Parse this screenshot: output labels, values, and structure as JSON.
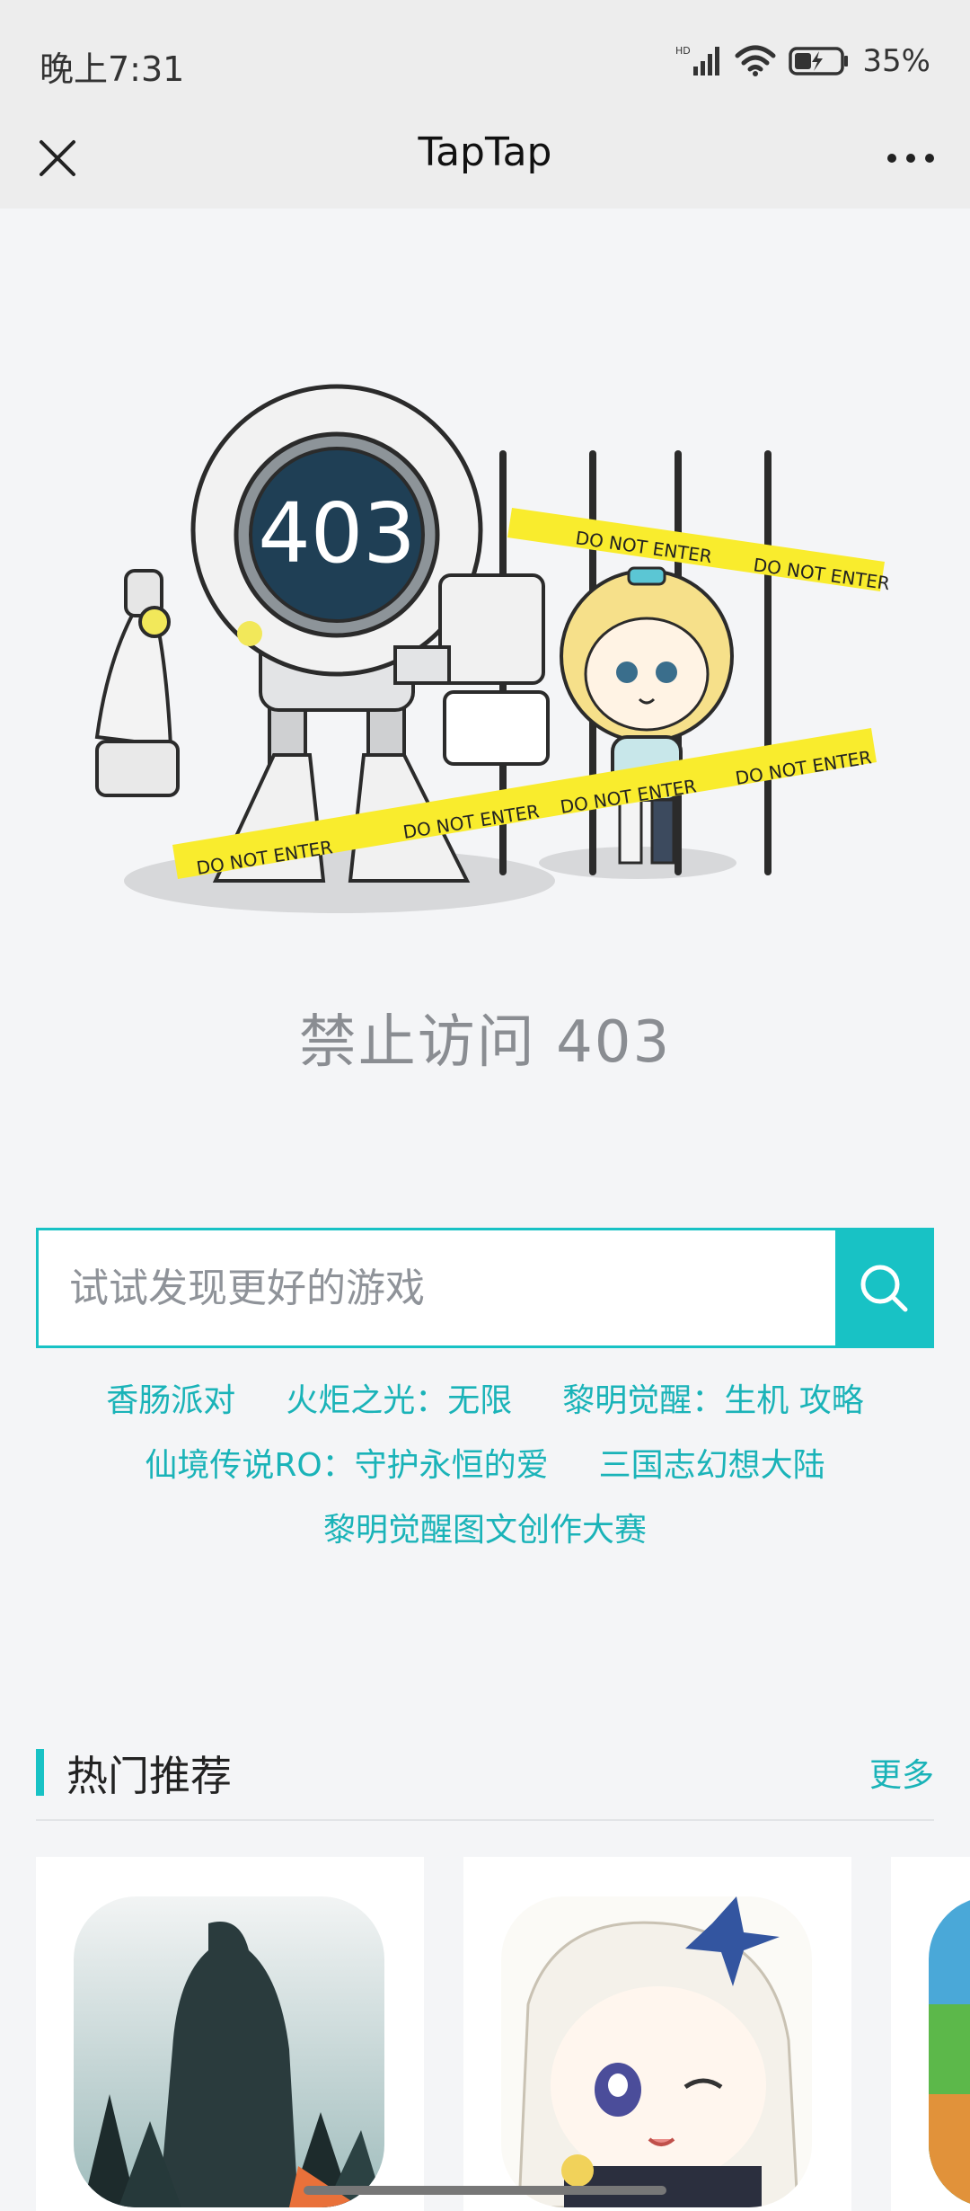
{
  "status_bar": {
    "time": "晚上7:31",
    "battery": "35%",
    "network": "HD"
  },
  "nav": {
    "title": "TapTap"
  },
  "illustration": {
    "screen_code": "403",
    "tape_text": "DO NOT ENTER"
  },
  "error": {
    "title": "禁止访问 403"
  },
  "search": {
    "placeholder": "试试发现更好的游戏"
  },
  "keywords": [
    "香肠派对",
    "火炬之光：无限",
    "黎明觉醒：生机 攻略",
    "仙境传说RO：守护永恒的爱",
    "三国志幻想大陆",
    "黎明觉醒图文创作大赛"
  ],
  "recommend": {
    "title": "热门推荐",
    "more": "更多"
  },
  "colors": {
    "accent": "#18c2c5",
    "link": "#1ab3b8",
    "background": "#f4f5f7"
  }
}
